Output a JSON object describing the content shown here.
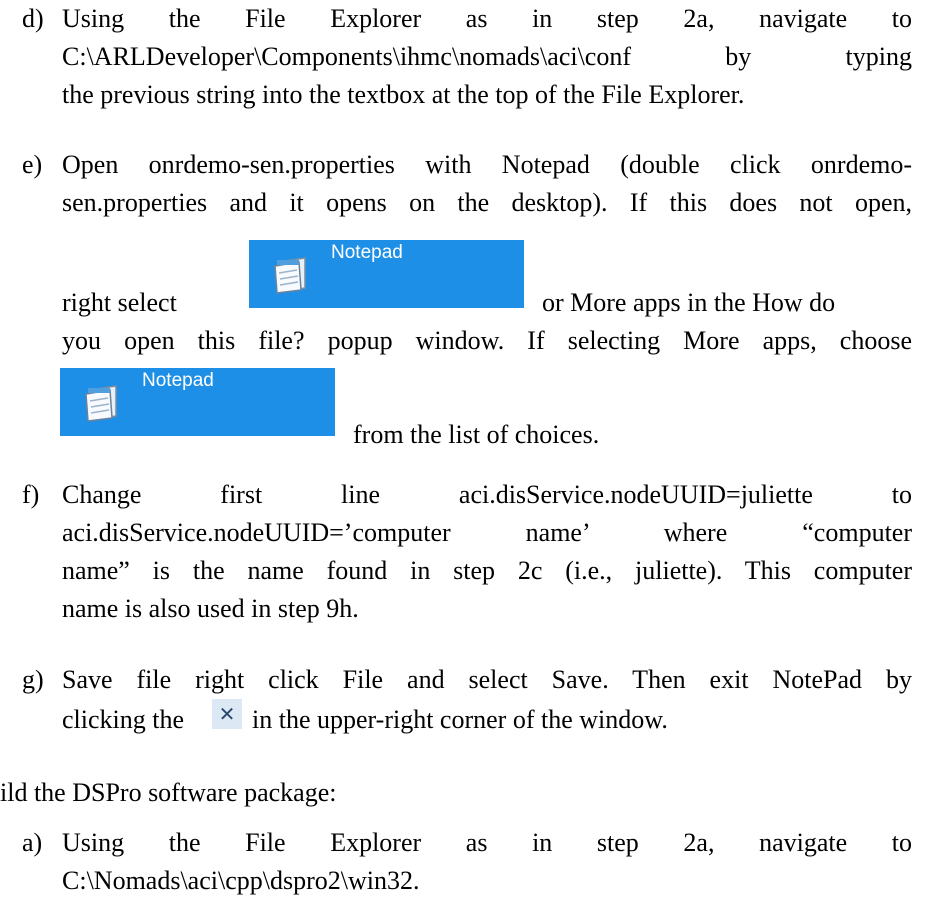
{
  "steps": {
    "d": {
      "marker": "d)",
      "lines": [
        "Using the File Explorer as in step 2a, navigate to",
        "C:\\ARLDeveloper\\Components\\ihmc\\nomads\\aci\\conf by typing",
        "the previous string into the textbox at the top of the File Explorer."
      ]
    },
    "e": {
      "marker": "e)",
      "lines": [
        "Open onrdemo-sen.properties with Notepad (double click onrdemo-",
        "sen.properties and it opens on the desktop). If this does not open,",
        "right select",
        "or More apps in the How do",
        "you open this file? popup window. If selecting More apps, choose",
        "from the list of choices."
      ],
      "notepad_label": "Notepad"
    },
    "f": {
      "marker": "f)",
      "lines": [
        "Change first line aci.disService.nodeUUID=juliette to",
        "aci.disService.nodeUUID=’computer name’ where “computer",
        "name” is the name found in step 2c (i.e., juliette). This computer",
        "name is also used in step 9h."
      ]
    },
    "g": {
      "marker": "g)",
      "lines": [
        "Save file right click File and select Save. Then exit NotePad by",
        "clicking the",
        "in the upper-right corner of the window."
      ],
      "close_glyph": "✕"
    }
  },
  "section_heading": "ild the DSPro software package:",
  "steps2": {
    "a": {
      "marker": "a)",
      "lines": [
        "Using the File Explorer as in step 2a, navigate to",
        "C:\\Nomads\\aci\\cpp\\dspro2\\win32."
      ]
    }
  },
  "colors": {
    "notepad_button": "#1e8fe6",
    "close_button_bg": "#dce8f3",
    "close_glyph": "#2b4a6f"
  }
}
